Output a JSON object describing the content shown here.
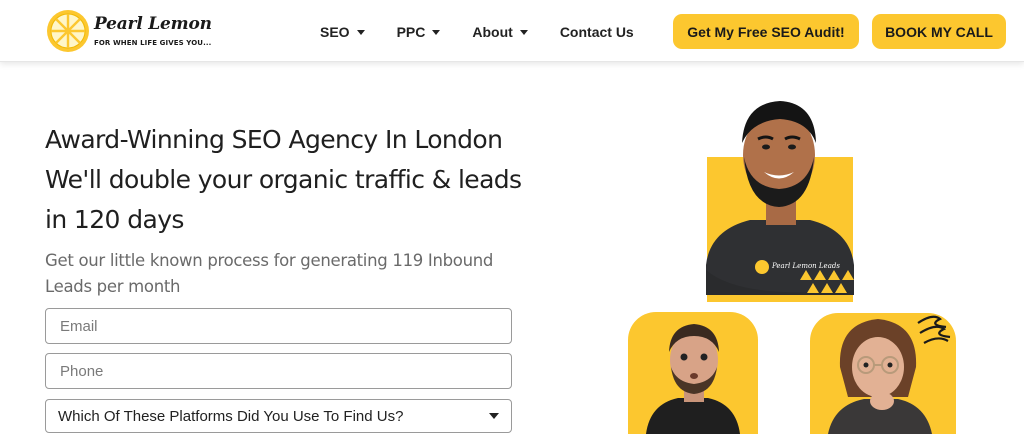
{
  "brand": {
    "name": "Pearl Lemon",
    "tagline": "FOR WHEN LIFE GIVES YOU..."
  },
  "nav": {
    "items": [
      {
        "label": "SEO",
        "has_dropdown": true
      },
      {
        "label": "PPC",
        "has_dropdown": true
      },
      {
        "label": "About",
        "has_dropdown": true
      },
      {
        "label": "Contact Us",
        "has_dropdown": false
      }
    ]
  },
  "header_buttons": {
    "audit_label": "Get My Free SEO Audit!",
    "book_label": "BOOK MY CALL"
  },
  "hero": {
    "title_line1": "Award-Winning SEO Agency In London",
    "title_line2": "We'll double your organic traffic & leads",
    "title_line3": "in 120 days",
    "subtitle": "Get our little known process for generating 119 Inbound Leads per month"
  },
  "form": {
    "email_placeholder": "Email",
    "phone_placeholder": "Phone",
    "platform_select": "Which Of These Platforms Did You Use To Find Us?"
  },
  "shirt_logo": {
    "text": "Pearl Lemon Leads"
  },
  "colors": {
    "accent": "#fcc72f",
    "text_dark": "#1f1f1f",
    "text_muted": "#6a6a6a"
  }
}
